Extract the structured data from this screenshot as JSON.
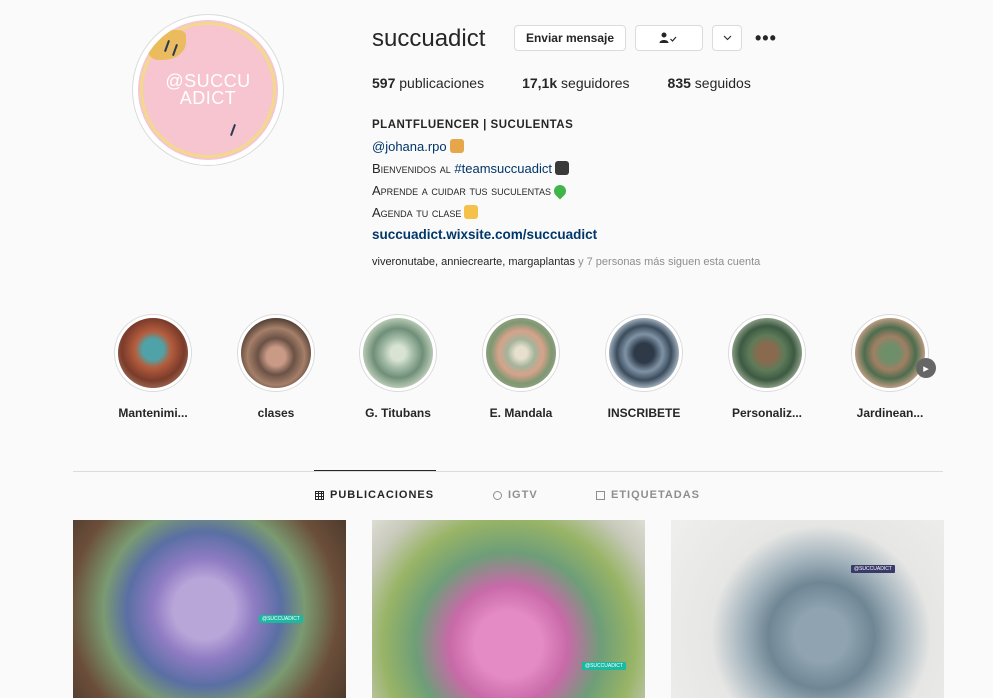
{
  "profile": {
    "username": "succuadict",
    "avatar_text": "@SUCCU ADICT",
    "message_button": "Enviar mensaje",
    "follow_icon": "person-check-icon",
    "dropdown_icon": "chevron-down-icon",
    "more": "•••",
    "stats": {
      "posts_count": "597",
      "posts_label": " publicaciones",
      "followers_count": "17,1k",
      "followers_label": " seguidores",
      "following_count": "835",
      "following_label": " seguidos"
    },
    "bio": {
      "name": "PLANTFLUENCER | SUCULENTAS",
      "mention": "@johana.rpo",
      "line1_text": "Bienvenidos al ",
      "line1_tag": "#teamsuccuadict",
      "line2": "Aprende a cuidar tus suculentas",
      "line3": "Agenda tu clase",
      "url": "succuadict.wixsite.com/succuadict"
    },
    "followed_by": {
      "names": "viveronutabe, anniecrearte, margaplantas",
      "rest": " y 7 personas más siguen esta cuenta"
    }
  },
  "highlights": [
    {
      "label": "Mantenimi..."
    },
    {
      "label": "clases"
    },
    {
      "label": "G. Titubans"
    },
    {
      "label": "E. Mandala"
    },
    {
      "label": "INSCRIBETE"
    },
    {
      "label": "Personaliz..."
    },
    {
      "label": "Jardinean..."
    }
  ],
  "tabs": {
    "posts": "PUBLICACIONES",
    "igtv": "IGTV",
    "tagged": "ETIQUETADAS"
  },
  "posts": [
    {
      "tag": "@SUCCUADICT"
    },
    {
      "tag": "@SUCCUADICT"
    },
    {
      "tag": "@SUCCUADICT"
    }
  ],
  "colors": {
    "link": "#00376b",
    "accent_pink": "#f6c5cf",
    "border": "#dbdbdb",
    "muted": "#8e8e8e"
  }
}
